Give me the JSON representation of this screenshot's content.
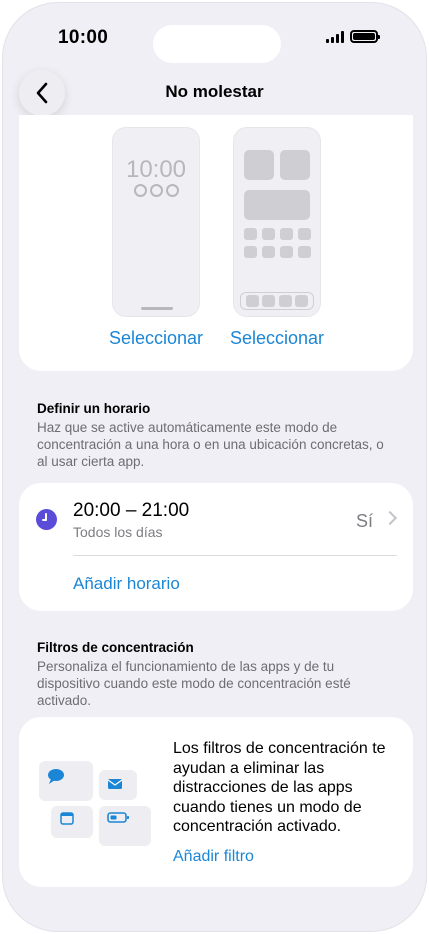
{
  "status_bar": {
    "time": "10:00"
  },
  "nav": {
    "title": "No molestar"
  },
  "screens": {
    "lock_time": "10:00",
    "lock_select": "Seleccionar",
    "home_select": "Seleccionar"
  },
  "schedule_section": {
    "title": "Definir un horario",
    "description": "Haz que se active automáticamente este modo de concentración a una hora o en una ubicación concretas, o al usar cierta app.",
    "item_time": "20:00 – 21:00",
    "item_days": "Todos los días",
    "item_value": "Sí",
    "add_label": "Añadir horario"
  },
  "filters_section": {
    "title": "Filtros de concentración",
    "description": "Personaliza el funcionamiento de las apps y de tu dispositivo cuando este modo de concentración esté activado.",
    "card_text": "Los filtros de concentración te ayudan a eliminar las distracciones de las apps cuando tienes un modo de concentración activado.",
    "add_label": "Añadir filtro"
  },
  "colors": {
    "accent": "#1b86d6",
    "clock": "#5b4bd9",
    "background": "#efeff5"
  }
}
